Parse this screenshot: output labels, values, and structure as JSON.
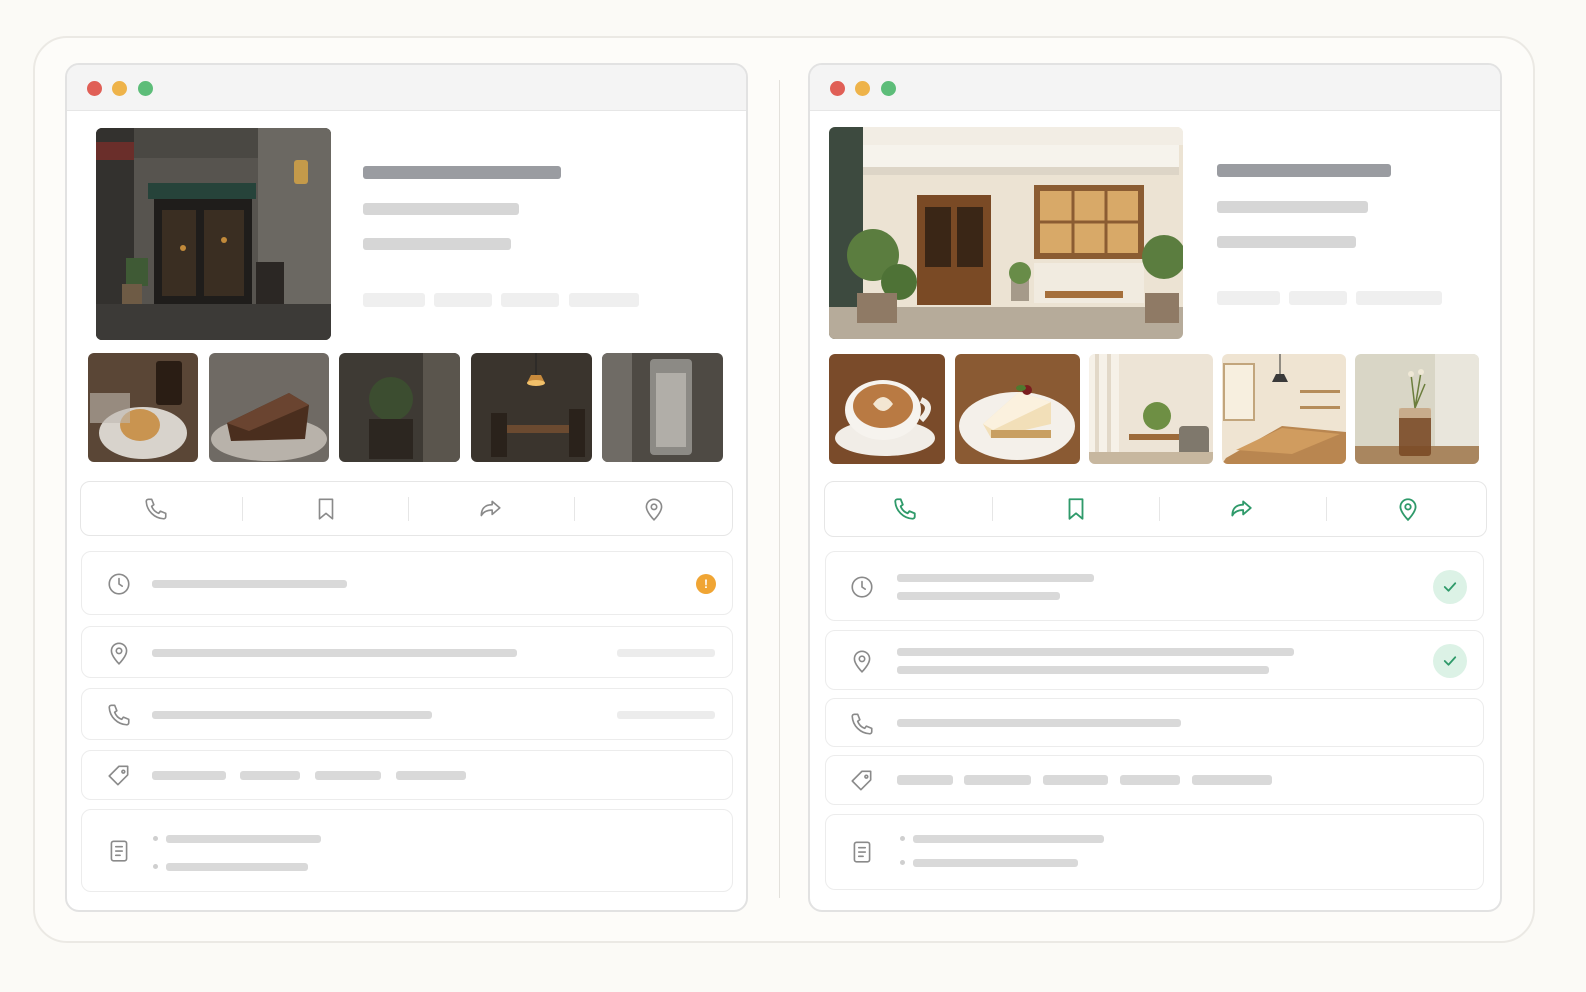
{
  "colors": {
    "neutral_icon": "#8a8a8a",
    "accent_green": "#2f9a6a",
    "warning": "#f0a534",
    "success_bg": "#dcf2e6"
  },
  "left_panel": {
    "window_controls": [
      "close",
      "minimize",
      "zoom"
    ],
    "hero_image": "dim-cafe-storefront",
    "thumbnails": [
      "pastry-and-iced-coffee",
      "chocolate-cake-slice",
      "potted-plant-corner",
      "table-under-pendant-lamp",
      "iced-drink-glass"
    ],
    "actions": [
      "phone-icon",
      "bookmark-icon",
      "share-icon",
      "location-pin-icon"
    ],
    "info_rows": [
      "clock-icon",
      "location-pin-icon",
      "phone-icon",
      "tag-icon",
      "document-icon"
    ],
    "hours_status_badge": "!"
  },
  "right_panel": {
    "window_controls": [
      "close",
      "minimize",
      "zoom"
    ],
    "hero_image": "bright-cafe-storefront",
    "thumbnails": [
      "latte-art-cup",
      "cheesecake-slice",
      "bright-seating-area",
      "long-wooden-table",
      "iced-coffee-with-flowers"
    ],
    "actions": [
      "phone-icon",
      "bookmark-icon",
      "share-icon",
      "location-pin-icon"
    ],
    "info_rows": [
      "clock-icon",
      "location-pin-icon",
      "phone-icon",
      "tag-icon",
      "document-icon"
    ],
    "verified_rows": [
      "hours",
      "address"
    ]
  }
}
